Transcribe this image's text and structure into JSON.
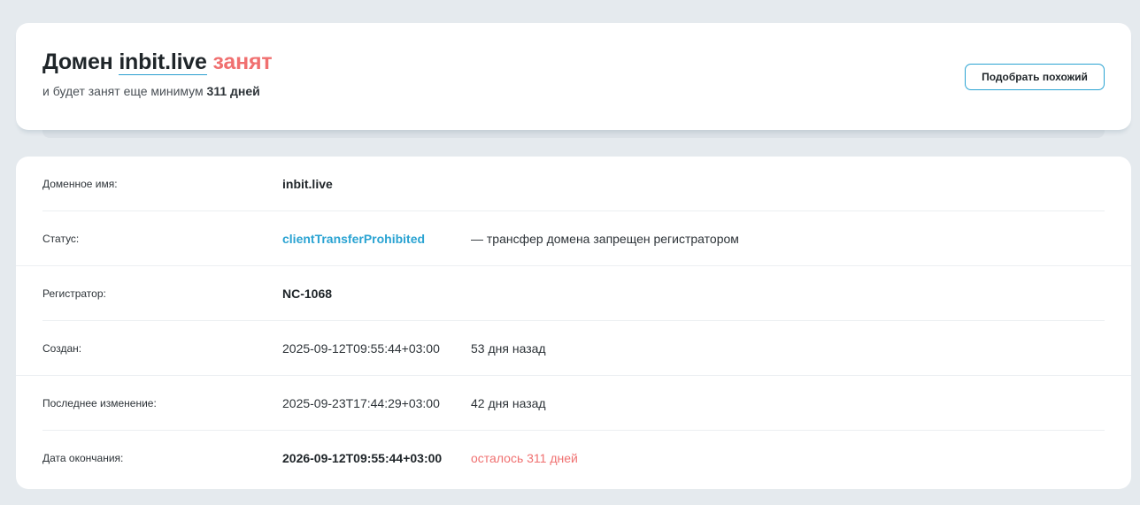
{
  "header": {
    "prefix": "Домен",
    "domain": "inbit.live",
    "status_word": "занят",
    "subtitle_text": "и будет занят еще минимум",
    "subtitle_days": "311 дней",
    "button_label": "Подобрать похожий"
  },
  "info": {
    "rows": [
      {
        "label": "Доменное имя:",
        "value": "inbit.live",
        "extra": ""
      },
      {
        "label": "Статус:",
        "value": "clientTransferProhibited",
        "extra": "— трансфер домена запрещен регистратором"
      },
      {
        "label": "Регистратор:",
        "value": "NC-1068",
        "extra": ""
      },
      {
        "label": "Создан:",
        "value": "2025-09-12T09:55:44+03:00",
        "extra": "53 дня назад"
      },
      {
        "label": "Последнее изменение:",
        "value": "2025-09-23T17:44:29+03:00",
        "extra": "42 дня назад"
      },
      {
        "label": "Дата окончания:",
        "value": "2026-09-12T09:55:44+03:00",
        "extra": "осталось 311 дней"
      }
    ]
  },
  "colors": {
    "accent": "#2aa3d2",
    "busy": "#f07070",
    "background": "#e5eaee"
  }
}
